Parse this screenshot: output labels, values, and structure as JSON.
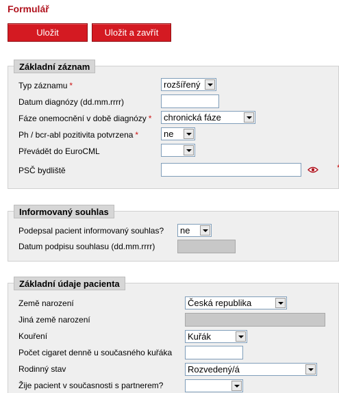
{
  "page_title": "Formulář",
  "buttons": {
    "save": "Uložit",
    "save_close": "Uložit a zavřít"
  },
  "sections": {
    "basic_record": {
      "legend": "Základní záznam",
      "fields": {
        "record_type": {
          "label": "Typ záznamu",
          "value": "rozšířený"
        },
        "diagnosis_date": {
          "label": "Datum diagnózy (dd.mm.rrrr)",
          "value": ""
        },
        "disease_phase": {
          "label": "Fáze onemocnění v době diagnózy",
          "value": "chronická fáze"
        },
        "ph_positivity": {
          "label": "Ph / bcr-abl pozitivita potvrzena",
          "value": "ne"
        },
        "eurocml": {
          "label": "Převádět do EuroCML",
          "value": ""
        },
        "postal_code": {
          "label": "PSČ bydliště",
          "value": ""
        }
      }
    },
    "informed_consent": {
      "legend": "Informovaný souhlas",
      "fields": {
        "signed": {
          "label": "Podepsal pacient informovaný souhlas?",
          "value": "ne"
        },
        "sign_date": {
          "label": "Datum podpisu souhlasu (dd.mm.rrrr)",
          "value": ""
        }
      }
    },
    "patient_info": {
      "legend": "Základní údaje pacienta",
      "fields": {
        "birth_country": {
          "label": "Země narození",
          "value": "Česká republika"
        },
        "other_country": {
          "label": "Jiná země narození",
          "value": ""
        },
        "smoking": {
          "label": "Kouření",
          "value": "Kuřák"
        },
        "cigarettes": {
          "label": "Počet cigaret denně u současného kuřáka",
          "value": ""
        },
        "marital_status": {
          "label": "Rodinný stav",
          "value": "Rozvedený/á"
        },
        "partner": {
          "label": "Žije pacient v současnosti s partnerem?",
          "value": ""
        }
      }
    }
  },
  "colors": {
    "accent": "#d41a22",
    "title": "#b0121d",
    "required": "#cc1111"
  },
  "icons": {
    "eye": "eye-icon"
  }
}
